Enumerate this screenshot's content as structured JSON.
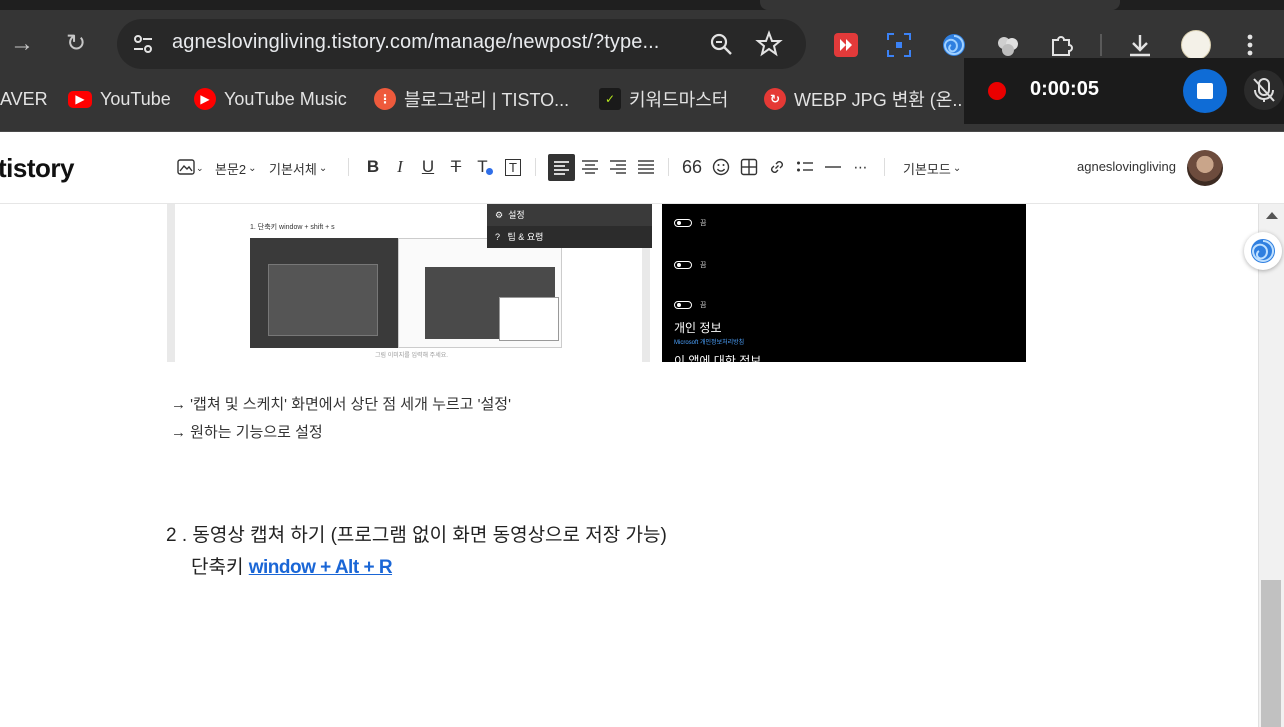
{
  "browser": {
    "url": "agneslovingliving.tistory.com/manage/newpost/?type...",
    "bookmarks": [
      {
        "label": "AVER"
      },
      {
        "label": "YouTube"
      },
      {
        "label": "YouTube Music"
      },
      {
        "label": "블로그관리 | TISTO..."
      },
      {
        "label": "키워드마스터"
      },
      {
        "label": "WEBP JPG 변환 (온..."
      }
    ]
  },
  "recorder": {
    "elapsed": "0:00:05"
  },
  "editor": {
    "logo": "tistory",
    "format_style": "본문2",
    "font": "기본서체",
    "mode": "기본모드",
    "username": "agneslovingliving"
  },
  "content": {
    "embedded_left": {
      "caption": "1. 단축키 window + shift + s",
      "menu_settings": "설정",
      "menu_tips": "팁 & 요령",
      "footer": "그림 이미지를 입력해 주세요."
    },
    "embedded_right": {
      "section_title": "개인 정보",
      "link": "Microsoft 개인정보처리방침",
      "next_title": "이 앱에 대한 정보",
      "toggle_label": "끔"
    },
    "line1": "→  '캡쳐 및 스케치' 화면에서 상단 점 세개 누르고 '설정'",
    "line2": "→ 원하는 기능으로 설정",
    "heading2": "2 . 동영상 캡쳐 하기 (프로그램 없이 화면 동영상으로 저장 가능)",
    "shortcut_label": "단축키 ",
    "shortcut_keys": "window + Alt + R"
  }
}
